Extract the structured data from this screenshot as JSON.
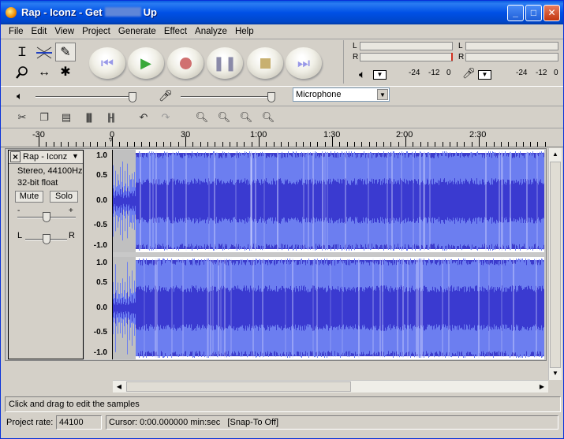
{
  "window": {
    "title_prefix": "Rap - Iconz - Get",
    "title_suffix": "Up",
    "min_glyph": "_",
    "max_glyph": "□",
    "close_glyph": "✕"
  },
  "menu": [
    "File",
    "Edit",
    "View",
    "Project",
    "Generate",
    "Effect",
    "Analyze",
    "Help"
  ],
  "tools": [
    "selection-tool",
    "envelope-tool",
    "draw-tool",
    "zoom-tool",
    "timeshift-tool",
    "multi-tool"
  ],
  "meters": {
    "play": {
      "ticks": [
        "-24",
        "-12",
        "0"
      ],
      "channels": [
        "L",
        "R"
      ]
    },
    "record": {
      "ticks": [
        "-24",
        "-12",
        "0"
      ],
      "channels": [
        "L",
        "R"
      ]
    }
  },
  "mixer": {
    "input_source": "Microphone"
  },
  "ruler": {
    "labels": [
      "-30",
      "0",
      "30",
      "1:00",
      "1:30",
      "2:00",
      "2:30"
    ]
  },
  "track": {
    "name": "Rap - Iconz",
    "format": "Stereo, 44100Hz",
    "bitdepth": "32-bit float",
    "mute_label": "Mute",
    "solo_label": "Solo",
    "gain_minus": "-",
    "gain_plus": "+",
    "pan_left": "L",
    "pan_right": "R",
    "scale_labels": [
      "1.0",
      "0.5",
      "0.0",
      "-0.5",
      "-1.0"
    ]
  },
  "colors": {
    "wave_bg": "#3c3ccc",
    "wave_peak": "#6c7ef0",
    "wave_rms": "#3a3ad0",
    "track_bg": "#ffffff",
    "preroll": "#c0c0c0"
  },
  "status": {
    "hint": "Click and drag to edit the samples",
    "project_rate_label": "Project rate:",
    "project_rate_value": "44100",
    "cursor_text": "Cursor: 0:00.000000 min:sec",
    "snap_text": "[Snap-To Off]"
  }
}
